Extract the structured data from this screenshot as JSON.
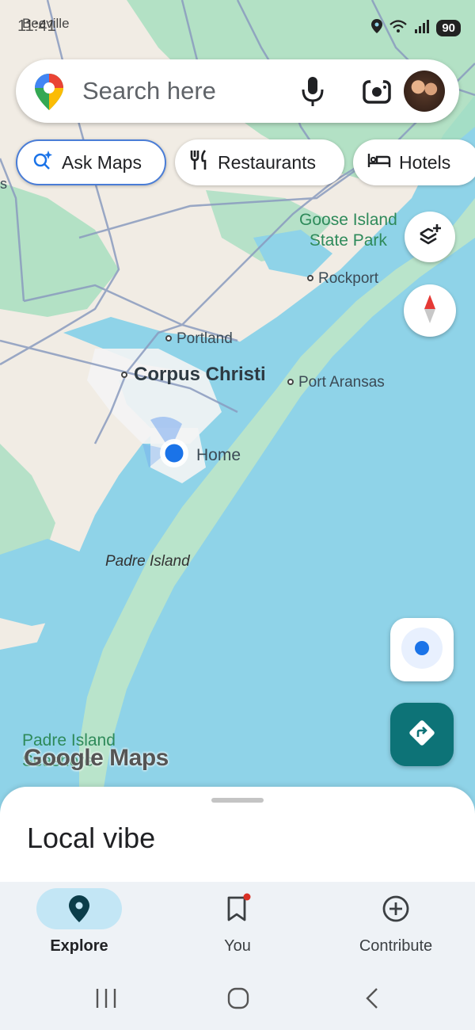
{
  "status_bar": {
    "time": "11:41",
    "location_label": "Beeville",
    "battery": "90"
  },
  "search": {
    "placeholder": "Search here"
  },
  "chips": [
    {
      "label": "Ask Maps",
      "icon": "sparkle-search-icon"
    },
    {
      "label": "Restaurants",
      "icon": "fork-knife-icon"
    },
    {
      "label": "Hotels",
      "icon": "bed-icon"
    }
  ],
  "map": {
    "labels": {
      "goose_island": "Goose Island\nState Park",
      "rockport": "Rockport",
      "portland": "Portland",
      "corpus_christi": "Corpus Christi",
      "port_aransas": "Port Aransas",
      "home": "Home",
      "padre_island": "Padre Island",
      "padre_island_seashore": "Padre Island\nSeashore",
      "edge_s": "s"
    },
    "attribution": "Google Maps",
    "colors": {
      "water": "#8fd3e8",
      "land": "#f1ece4",
      "park": "#a8dfc0",
      "road": "#8a9bbf"
    }
  },
  "sheet": {
    "title": "Local vibe"
  },
  "bottom_nav": [
    {
      "label": "Explore",
      "icon": "location-pin-icon",
      "active": true
    },
    {
      "label": "You",
      "icon": "bookmark-icon",
      "active": false
    },
    {
      "label": "Contribute",
      "icon": "add-circle-icon",
      "active": false
    }
  ]
}
